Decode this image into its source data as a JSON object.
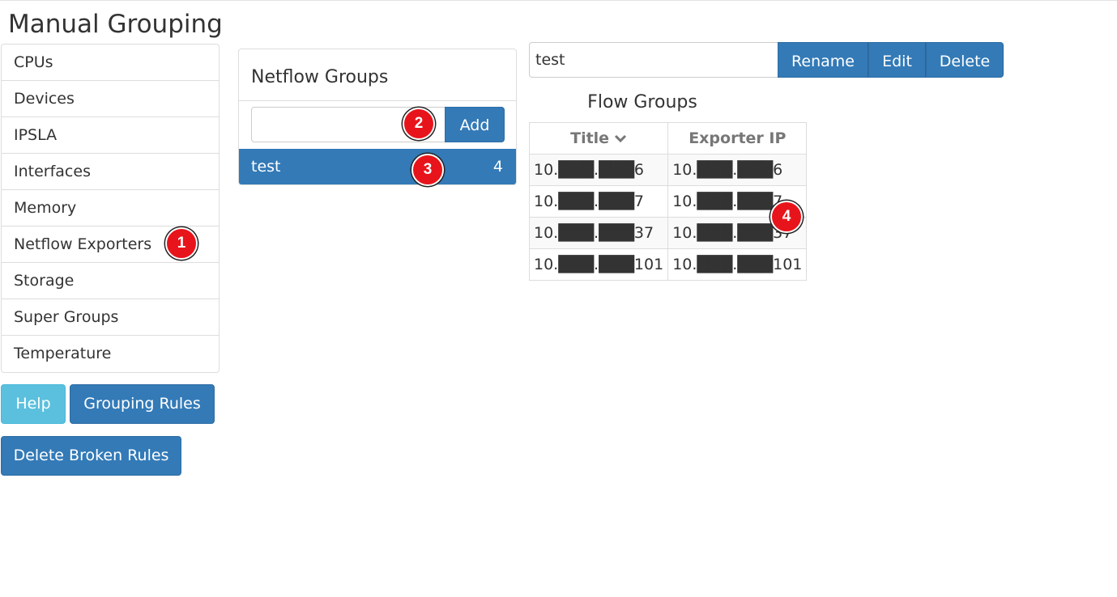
{
  "page": {
    "title": "Manual Grouping"
  },
  "sidebar": {
    "items": [
      {
        "label": "CPUs"
      },
      {
        "label": "Devices"
      },
      {
        "label": "IPSLA"
      },
      {
        "label": "Interfaces"
      },
      {
        "label": "Memory"
      },
      {
        "label": "Netflow Exporters"
      },
      {
        "label": "Storage"
      },
      {
        "label": "Super Groups"
      },
      {
        "label": "Temperature"
      }
    ]
  },
  "buttons": {
    "help": "Help",
    "grouping_rules": "Grouping Rules",
    "delete_broken_rules": "Delete Broken Rules"
  },
  "netflow_groups": {
    "heading": "Netflow Groups",
    "add_input_value": "",
    "add_label": "Add",
    "selected_group": {
      "name": "test",
      "count": "4"
    }
  },
  "group_editor": {
    "name_value": "test",
    "rename_label": "Rename",
    "edit_label": "Edit",
    "delete_label": "Delete"
  },
  "flow_groups_table": {
    "title": "Flow Groups",
    "columns": [
      "Title",
      "Exporter IP"
    ],
    "sort_icon": "chevron-down-icon",
    "rows": [
      [
        "10.███.███6",
        "10.███.███6"
      ],
      [
        "10.███.███7",
        "10.███.███7"
      ],
      [
        "10.███.███37",
        "10.███.███37"
      ],
      [
        "10.███.███101",
        "10.███.███101"
      ]
    ]
  },
  "annotations": [
    "1",
    "2",
    "3",
    "4"
  ],
  "colors": {
    "primary": "#337ab7",
    "info": "#5bc0de",
    "annotation": "#e8141b"
  }
}
